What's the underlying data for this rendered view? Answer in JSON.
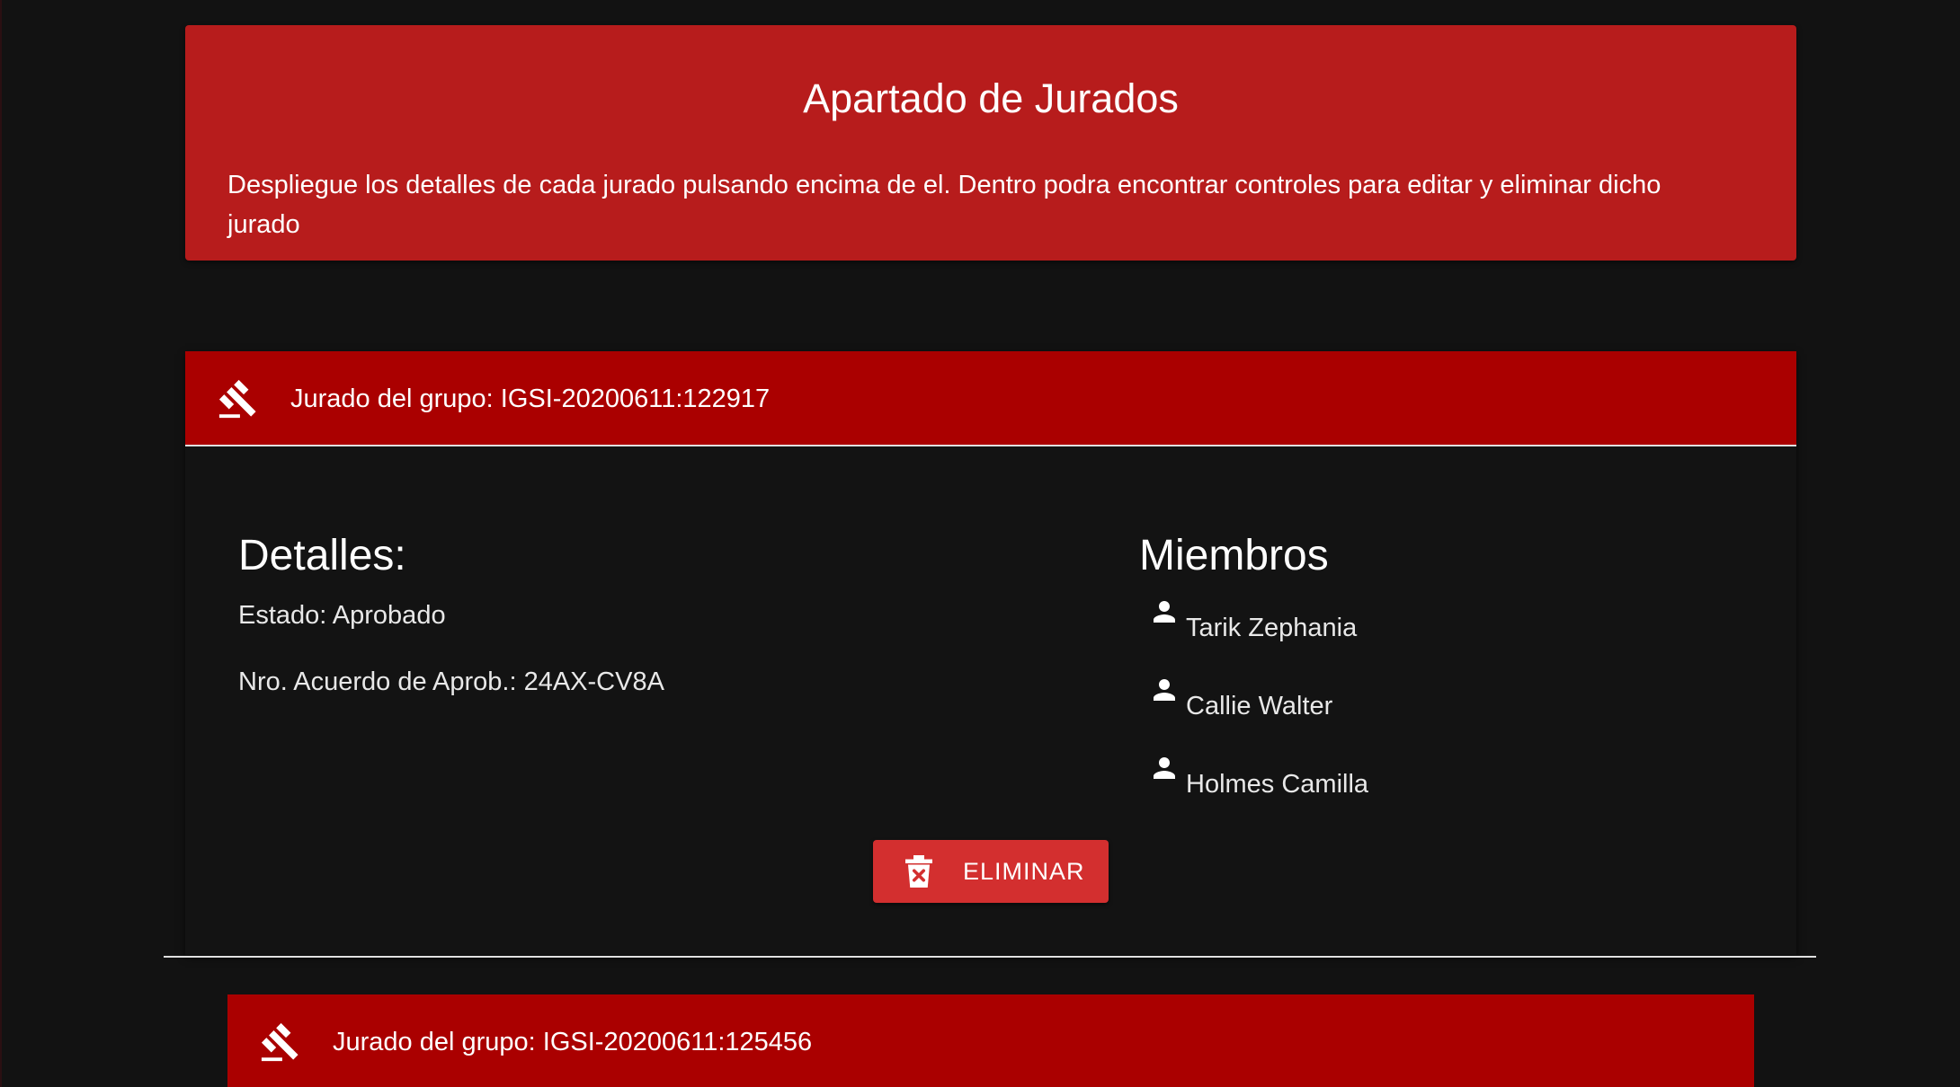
{
  "banner": {
    "title": "Apartado de Jurados",
    "description": "Despliegue los detalles de cada jurado pulsando encima de el. Dentro podra encontrar controles para editar y eliminar dicho jurado"
  },
  "panels": [
    {
      "header_label": "Jurado del grupo: IGSI-20200611:122917",
      "expanded": true,
      "details_title": "Detalles:",
      "estado": "Estado: Aprobado",
      "acuerdo": "Nro. Acuerdo de Aprob.: 24AX-CV8A",
      "members_title": "Miembros",
      "members": [
        "Tarik Zephania",
        "Callie Walter",
        "Holmes Camilla"
      ],
      "delete_label": "ELIMINAR",
      "header_icon": "gavel-icon",
      "member_icon": "person-icon",
      "delete_icon": "trash-icon"
    },
    {
      "header_label": "Jurado del grupo: IGSI-20200611:125456",
      "expanded": false,
      "header_icon": "gavel-icon"
    }
  ],
  "colors": {
    "background": "#121212",
    "banner": "#b71c1c",
    "panel_header": "#aa0000",
    "delete_button": "#d32f2f"
  }
}
